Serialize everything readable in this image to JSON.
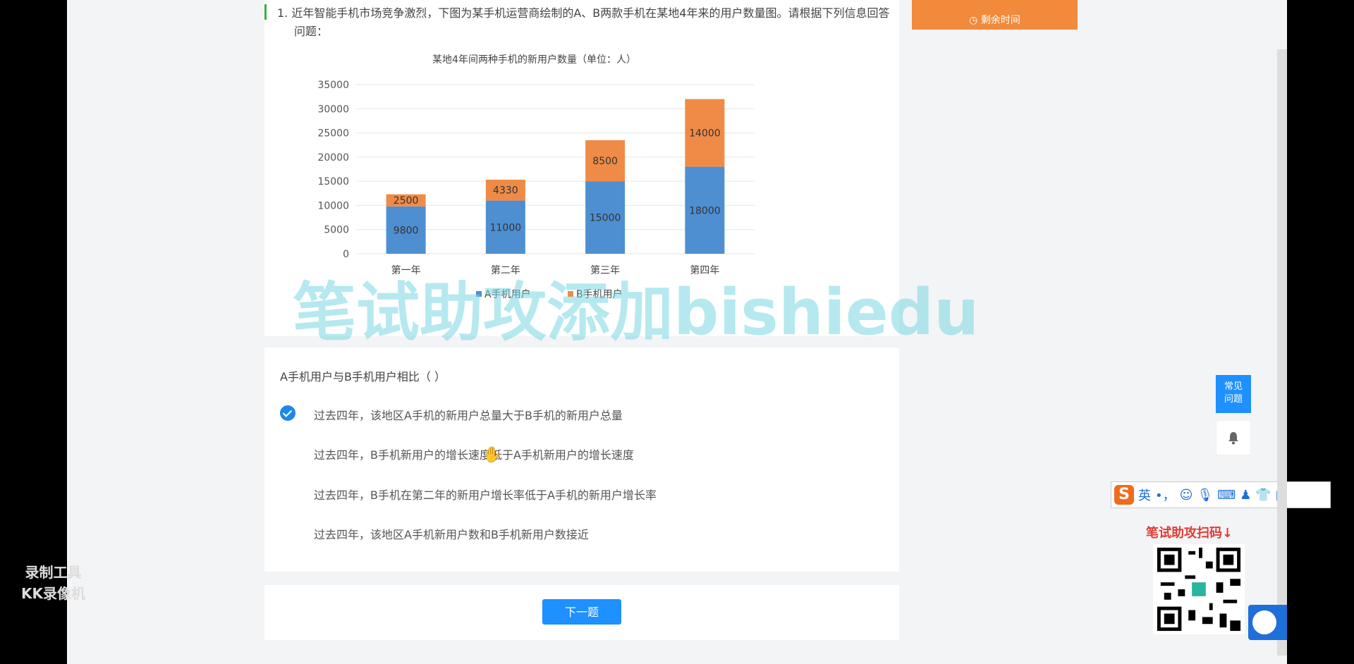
{
  "question": {
    "number": "1.",
    "text_line1": "近年智能手机市场竞争激烈，下图为某手机运营商绘制的A、B两款手机在某地4年来的用户数量图。请根据下列信息回答",
    "text_line2": "问题："
  },
  "chart_data": {
    "type": "bar",
    "stacked": true,
    "title": "某地4年间两种手机的新用户数量（单位：人）",
    "categories": [
      "第一年",
      "第二年",
      "第三年",
      "第四年"
    ],
    "series": [
      {
        "name": "A手机用户",
        "values": [
          9800,
          11000,
          15000,
          18000
        ],
        "color": "#4e8fd1"
      },
      {
        "name": "B手机用户",
        "values": [
          2500,
          4330,
          8500,
          14000
        ],
        "color": "#ef8b47"
      }
    ],
    "ylim": [
      0,
      35000
    ],
    "yticks": [
      "0",
      "5000",
      "10000",
      "15000",
      "20000",
      "25000",
      "30000",
      "35000"
    ],
    "grid": true,
    "legend": "bottom"
  },
  "options": {
    "prompt": "A手机用户与B手机用户相比（ ）",
    "items": [
      {
        "label": "过去四年，该地区A手机的新用户总量大于B手机的新用户总量",
        "checked": true
      },
      {
        "label": "过去四年，B手机新用户的增长速度低于A手机新用户的增长速度",
        "checked": false
      },
      {
        "label": "过去四年，B手机在第二年的新用户增长率低于A手机的新用户增长率",
        "checked": false
      },
      {
        "label": "过去四年，该地区A手机新用户数和B手机新用户数接近",
        "checked": false
      }
    ]
  },
  "next_button": "下一题",
  "timer": {
    "label": "剩余时间"
  },
  "side": {
    "faq_line1": "常见",
    "faq_line2": "问题"
  },
  "ime": {
    "lang": "英",
    "punct": "•，"
  },
  "qr_title": "笔试助攻扫码↓",
  "watermark": "笔试助攻添加bishiedu",
  "recorder": {
    "line1": "录制工具",
    "line2": "KK录像机"
  },
  "colors": {
    "accent": "#1e90ff",
    "timer": "#f18a3a",
    "seriesA": "#4e8fd1",
    "seriesB": "#ef8b47"
  }
}
